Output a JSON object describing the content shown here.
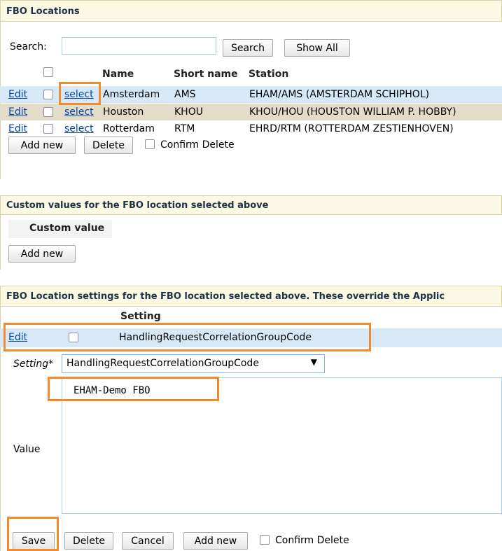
{
  "fbo_locations": {
    "title": "FBO Locations",
    "search_label": "Search:",
    "search_value": "",
    "search_button": "Search",
    "show_all_button": "Show All",
    "columns": [
      "Name",
      "Short name",
      "Station"
    ],
    "rows": [
      {
        "edit": "Edit",
        "select": "select",
        "name": "Amsterdam",
        "short": "AMS",
        "station": "EHAM/AMS (AMSTERDAM SCHIPHOL)"
      },
      {
        "edit": "Edit",
        "select": "select",
        "name": "Houston",
        "short": "KHOU",
        "station": "KHOU/HOU (HOUSTON WILLIAM P. HOBBY)"
      },
      {
        "edit": "Edit",
        "select": "select",
        "name": "Rotterdam",
        "short": "RTM",
        "station": "EHRD/RTM (ROTTERDAM ZESTIENHOVEN)"
      }
    ],
    "add_new_button": "Add new",
    "delete_button": "Delete",
    "confirm_delete_label": "Confirm Delete"
  },
  "custom_values": {
    "title": "Custom values for the FBO location selected above",
    "column": "Custom value",
    "add_new_button": "Add new"
  },
  "location_settings": {
    "title": "FBO Location settings for the FBO location selected above. These override the Applic",
    "column": "Setting",
    "row": {
      "edit": "Edit",
      "setting": "HandlingRequestCorrelationGroupCode"
    },
    "setting_label": "Setting*",
    "setting_selected": "HandlingRequestCorrelationGroupCode",
    "value_label": "Value",
    "value_text": "EHAM-Demo FBO",
    "save_button": "Save",
    "delete_button": "Delete",
    "cancel_button": "Cancel",
    "add_new_button": "Add new",
    "confirm_delete_label": "Confirm Delete"
  },
  "colors": {
    "panel_header_bg": "#fbf9e4",
    "selected_row_bg": "#d7e9f7",
    "alt_row_bg": "#e3dcc8",
    "highlight_border": "#f28a30",
    "link": "#0645ad"
  }
}
